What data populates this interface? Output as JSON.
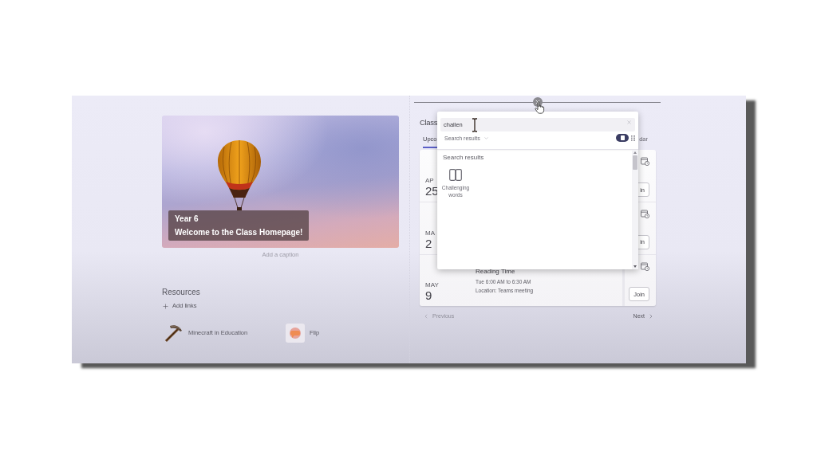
{
  "photo": {
    "banner_lines": [
      "Year 6",
      "Welcome to the Class Homepage!"
    ],
    "caption": {
      "placeholder": "Add a caption"
    }
  },
  "resources": {
    "title": "Resources",
    "add_button": "Add links",
    "links": [
      {
        "label": "Minecraft in Education",
        "kind": "pickaxe"
      },
      {
        "label": "Flip",
        "kind": "bubble"
      }
    ]
  },
  "calendar_panel": {
    "title": "Class",
    "tabs": [
      {
        "label": "Upco",
        "selected": true
      },
      {
        "label": "dar",
        "selected": false
      }
    ],
    "events": [
      {
        "month": "AP",
        "day": "25",
        "join": "in"
      },
      {
        "month": "MA",
        "day": "2",
        "join": "in"
      },
      {
        "month": "MAY",
        "day": "9",
        "title": "Reading Time",
        "time": "Tue 6:00 AM to 6:30 AM",
        "location": "Location: Teams meeting",
        "join": "Join"
      }
    ],
    "previous": {
      "label": "Previous",
      "disabled": true
    },
    "next": {
      "label": "Next",
      "disabled": false
    }
  },
  "search_popup": {
    "query": "challen",
    "scope": "Search results",
    "views": [
      {
        "kind": "tile",
        "selected": true
      },
      {
        "kind": "list",
        "selected": false
      }
    ],
    "results_heading": "Search results",
    "results": [
      {
        "label": "Challenging words"
      }
    ]
  }
}
